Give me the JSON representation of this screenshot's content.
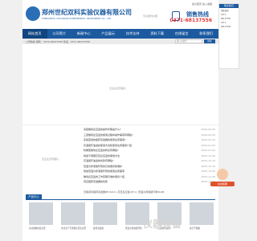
{
  "header": {
    "company_name": "郑州世纪双科实验仪器有限公司",
    "company_en": "ZHENGZHOU SHUANGKE EXPERIMENTAL INSTRUMENT CO., LTD.",
    "top_links": "加为首页  加入收藏",
    "note": "专注国内仪器",
    "hotline_label": "销售热线",
    "hotline_number": "0371-68137556"
  },
  "nav": {
    "items": [
      {
        "label": "网站首页",
        "active": true
      },
      {
        "label": "公司简介"
      },
      {
        "label": "新闻中心"
      },
      {
        "label": "产品展示"
      },
      {
        "label": "技术支持"
      },
      {
        "label": "资料下载"
      },
      {
        "label": "在线留言"
      },
      {
        "label": "联系我们"
      }
    ]
  },
  "bar": {
    "text": "公司热线  销售：0371-68137556  售后：0371-68137556",
    "search_placeholder": "输入关键字",
    "search_button": "搜索"
  },
  "banner": {
    "placeholder": "无企业宣传图片"
  },
  "left_panel": {
    "placeholder": "无企业宣传图片"
  },
  "news": [
    {
      "title": "双层玻璃反应釜的操作步骤是什么?",
      "date": "2024-02-25"
    },
    {
      "title": "三层玻璃反应釜的使用过程中操作事项有哪些?",
      "date": "2024-02-25"
    },
    {
      "title": "实验室用的旋转蒸发器的使用注意事项?",
      "date": "2024-01-16"
    },
    {
      "title": "高温循环油浴的使用方法和使用注意事项介绍",
      "date": "2024-01-09"
    },
    {
      "title": "防爆型玻璃反应釜的特点有哪些?",
      "date": "2024-01-02"
    },
    {
      "title": "简述不锈钢高压反应釜的使用方法",
      "date": "2023-12-26"
    },
    {
      "title": "高温循环油浴的优势有哪些?",
      "date": "2023-12-19"
    },
    {
      "title": "低温冷却液循环泵的日常保养和维护",
      "date": "2023-12-12"
    },
    {
      "title": "简述低温冷却液循环泵的使用注意事项",
      "date": "2023-12-05"
    },
    {
      "title": "玻璃反应釜的工作原理与维护保养介绍",
      "date": "2023-11-28"
    },
    {
      "title": "真空旋转蒸发器的优势",
      "date": "2023-11-21"
    }
  ],
  "ticker": "无锡双科旋转蒸发器RE-5210 | 高压反应釜CJF-1 | 低温冷却液循环泵DLSB",
  "products": {
    "title": "产品中心",
    "items": [
      {
        "caption": "多功能玻璃反应釜"
      },
      {
        "caption": "专业生产不锈钢高压反应釜"
      },
      {
        "caption": "旋转蒸发器"
      },
      {
        "caption": "低温冷却液循环泵"
      },
      {
        "caption": "高温循环油浴"
      },
      {
        "caption": "真空干燥箱"
      }
    ]
  },
  "side": {
    "title": "联系我们",
    "lines": [
      "销售热线",
      "0371-",
      "68137556",
      "0371-",
      "68137556"
    ]
  },
  "service": {
    "button": "在线客服"
  },
  "watermark": "仪器设备"
}
